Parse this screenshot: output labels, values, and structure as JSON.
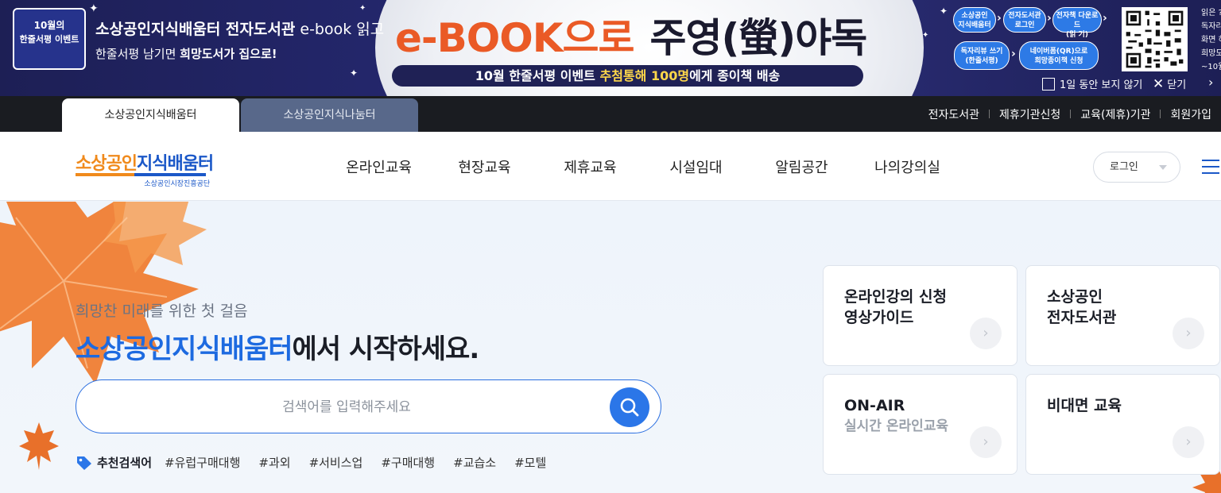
{
  "banner": {
    "badge_line1": "10월의",
    "badge_line2": "한줄서평 이벤트",
    "line1_bold": "소상공인지식배움터 전자도서관",
    "line1_rest": " e-book 읽고",
    "line2_prefix": "한줄서평 남기면 ",
    "line2_bold": "희망도서가 집으로!",
    "title_orange": "e-BOOK으로",
    "title_dark": "주영(螢)야독",
    "pill_prefix": "10월 한줄서평 이벤트 ",
    "pill_highlight1": "추첨통해",
    "pill_highlight2": "100명",
    "pill_suffix": "에게 종이책 배송",
    "steps": [
      {
        "line1": "소상공인",
        "line2": "지식배움터"
      },
      {
        "line1": "전자도서관",
        "line2": "로그인"
      },
      {
        "line1": "전자책 다운로드",
        "line2": "(읽 기)"
      },
      {
        "line1": "독자리뷰 쓰기",
        "line2": "(한줄서평)"
      },
      {
        "line1": "네이버폼(QR)으로",
        "line2": "희망종이책 신청"
      }
    ],
    "side_text": [
      "읽은 ?",
      "독자리",
      "화면 하",
      "희망도",
      "~10월"
    ],
    "no_show_today": "1일 동안 보지 않기",
    "close_label": "닫기",
    "next_label": "›"
  },
  "tabs": [
    {
      "label": "소상공인지식배움터"
    },
    {
      "label": "소상공인지식나눔터"
    }
  ],
  "util_links": [
    "전자도서관",
    "제휴기관신청",
    "교육(제휴)기관",
    "회원가입"
  ],
  "logo": {
    "part1": "소상공인",
    "part2": "지식배움터",
    "sub": "소상공인시장진흥공단"
  },
  "nav": [
    "온라인교육",
    "현장교육",
    "제휴교육",
    "시설임대",
    "알림공간",
    "나의강의실"
  ],
  "login_select": "로그인",
  "hero": {
    "subtitle": "희망찬 미래를 위한 첫 걸음",
    "title_blue": "소상공인지식배움터",
    "title_rest": "에서 시작하세요.",
    "search_placeholder": "검색어를 입력해주세요",
    "rec_label": "추천검색어",
    "keywords": [
      "#유럽구매대행",
      "#과외",
      "#서비스업",
      "#구매대행",
      "#교습소",
      "#모텔"
    ]
  },
  "cards": [
    {
      "title_line1": "온라인강의 신청",
      "title_line2": "영상가이드"
    },
    {
      "title_line1": "소상공인",
      "title_line2": "전자도서관"
    },
    {
      "title": "ON-AIR",
      "sub": "실시간 온라인교육"
    },
    {
      "title": "비대면 교육"
    }
  ],
  "colors": {
    "brand_blue": "#1d6ae0",
    "brand_orange": "#f08a1c",
    "banner_navy": "#23266a",
    "ebook_orange": "#ea5a26"
  },
  "icons": [
    "search-icon",
    "tag-icon",
    "chevron-right-icon",
    "close-icon",
    "hamburger-icon",
    "qr-code-icon",
    "maple-leaf-icon"
  ]
}
